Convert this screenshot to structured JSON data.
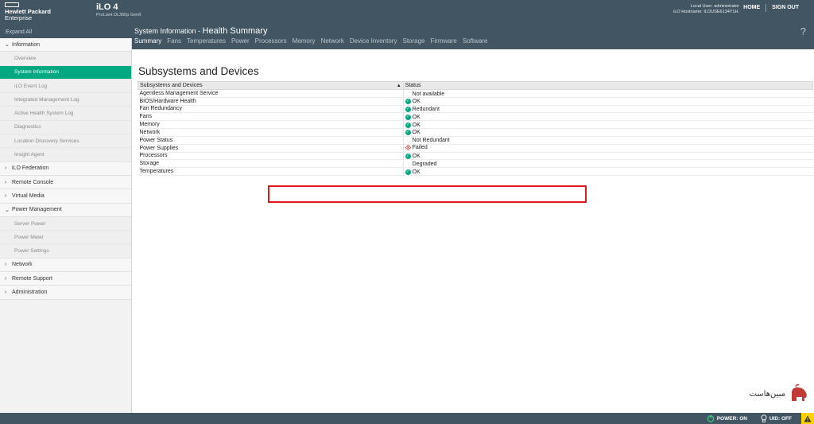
{
  "header": {
    "brand_line1": "Hewlett Packard",
    "brand_line2": "Enterprise",
    "product_name": "iLO 4",
    "product_subtitle": "ProLiant DL360p Gen8",
    "local_user": "Local User: administrator",
    "hostname": "iLO Hostname: ILOUSE6134Y1H.",
    "home_label": "HOME",
    "signout_label": "SIGN OUT"
  },
  "subheader": {
    "expand_all": "Expand All",
    "title_section": "System Information",
    "title_sep": " - ",
    "title_page": "Health Summary",
    "help": "?"
  },
  "tabs": [
    {
      "label": "Summary",
      "active": true
    },
    {
      "label": "Fans"
    },
    {
      "label": "Temperatures"
    },
    {
      "label": "Power"
    },
    {
      "label": "Processors"
    },
    {
      "label": "Memory"
    },
    {
      "label": "Network"
    },
    {
      "label": "Device Inventory"
    },
    {
      "label": "Storage"
    },
    {
      "label": "Firmware"
    },
    {
      "label": "Software"
    }
  ],
  "sidebar": {
    "information": "Information",
    "overview": "Overview",
    "system_information": "System Information",
    "ilo_event_log": "iLO Event Log",
    "integrated_management_log": "Integrated Management Log",
    "active_health_system_log": "Active Health System Log",
    "diagnostics": "Diagnostics",
    "location_discovery_services": "Location Discovery Services",
    "insight_agent": "Insight Agent",
    "ilo_federation": "iLO Federation",
    "remote_console": "Remote Console",
    "virtual_media": "Virtual Media",
    "power_management": "Power Management",
    "server_power": "Server Power",
    "power_meter": "Power Meter",
    "power_settings": "Power Settings",
    "network": "Network",
    "remote_support": "Remote Support",
    "administration": "Administration"
  },
  "content": {
    "heading": "Subsystems and Devices",
    "col1_header": "Subsystems and Devices",
    "col2_header": "Status",
    "sort_icon": "▲",
    "rows": [
      {
        "name": "Agentless Management Service",
        "status": "Not available",
        "icon": "none"
      },
      {
        "name": "BIOS/Hardware Health",
        "status": "OK",
        "icon": "ok-icon"
      },
      {
        "name": "Fan Redundancy",
        "status": "Redundant",
        "icon": "ok-icon"
      },
      {
        "name": "Fans",
        "status": "OK",
        "icon": "ok-icon"
      },
      {
        "name": "Memory",
        "status": "OK",
        "icon": "ok-icon"
      },
      {
        "name": "Network",
        "status": "OK",
        "icon": "ok-icon"
      },
      {
        "name": "Power Status",
        "status": "Not Redundant",
        "icon": "none"
      },
      {
        "name": "Power Supplies",
        "status": "Failed",
        "icon": "failed-icon"
      },
      {
        "name": "Processors",
        "status": "OK",
        "icon": "ok-icon"
      },
      {
        "name": "Storage",
        "status": "Degraded",
        "icon": "none"
      },
      {
        "name": "Temperatures",
        "status": "OK",
        "icon": "ok-icon"
      }
    ]
  },
  "statusbar": {
    "power": "POWER: ON",
    "uid": "UID: OFF"
  },
  "watermark": {
    "text": "مبین‌هاست"
  },
  "colors": {
    "header_bg": "#425563",
    "accent": "#01a982",
    "failed": "#e04545",
    "highlight_box": "#e01818",
    "alert": "#ffd200"
  }
}
